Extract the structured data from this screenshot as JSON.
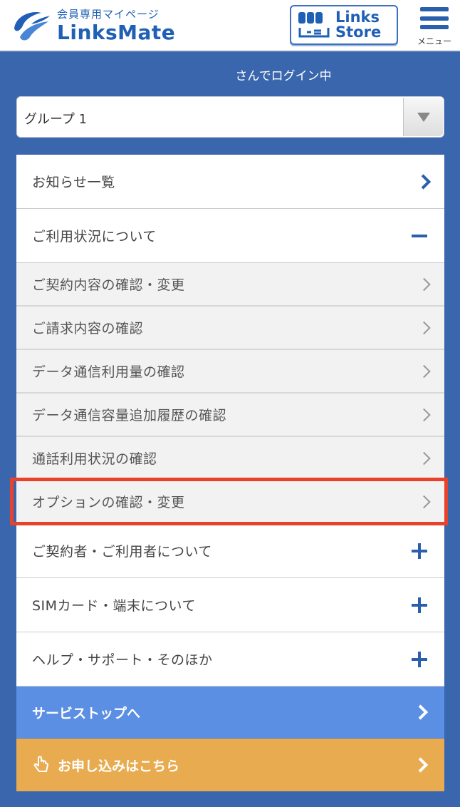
{
  "header": {
    "logo_sub": "会員専用マイページ",
    "logo_main": "LinksMate",
    "store_line1": "Links",
    "store_line2": "Store",
    "menu_label": "メニュー"
  },
  "status": {
    "login_text": "さんでログイン中"
  },
  "group": {
    "selected": "グループ 1"
  },
  "menu": {
    "items": [
      {
        "label": "お知らせ一覧",
        "kind": "top",
        "icon": "chevron-right-icon"
      },
      {
        "label": "ご利用状況について",
        "kind": "top",
        "icon": "minus-icon"
      },
      {
        "label": "ご契約内容の確認・変更",
        "kind": "sub",
        "icon": "chevron-right-icon"
      },
      {
        "label": "ご請求内容の確認",
        "kind": "sub",
        "icon": "chevron-right-icon"
      },
      {
        "label": "データ通信利用量の確認",
        "kind": "sub",
        "icon": "chevron-right-icon"
      },
      {
        "label": "データ通信容量追加履歴の確認",
        "kind": "sub",
        "icon": "chevron-right-icon"
      },
      {
        "label": "通話利用状況の確認",
        "kind": "sub",
        "icon": "chevron-right-icon"
      },
      {
        "label": "オプションの確認・変更",
        "kind": "sub",
        "icon": "chevron-right-icon"
      },
      {
        "label": "ご契約者・ご利用者について",
        "kind": "top",
        "icon": "plus-icon"
      },
      {
        "label": "SIMカード・端末について",
        "kind": "top",
        "icon": "plus-icon"
      },
      {
        "label": "ヘルプ・サポート・そのほか",
        "kind": "top",
        "icon": "plus-icon"
      }
    ],
    "service_stop": "サービストップへ",
    "apply": "お申し込みはこちら"
  },
  "colors": {
    "brand_blue": "#2b5fad",
    "background_blue": "#3a66ad",
    "service_stop_bg": "#5b8fe3",
    "apply_bg": "#e8ab50",
    "highlight": "#e8412c"
  }
}
